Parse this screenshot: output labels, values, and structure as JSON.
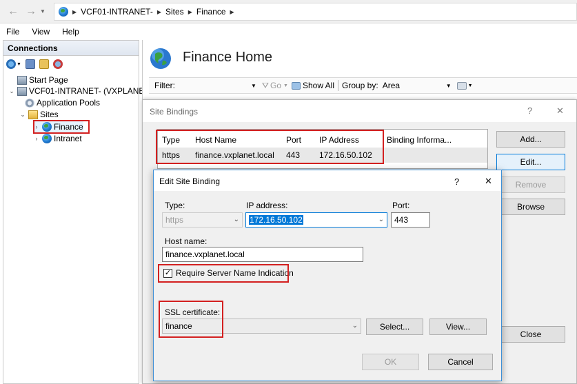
{
  "address": {
    "path": [
      "VCF01-INTRANET-",
      "Sites",
      "Finance"
    ]
  },
  "menu": [
    "File",
    "View",
    "Help"
  ],
  "connections": {
    "title": "Connections",
    "tree": {
      "start_page": "Start Page",
      "server": "VCF01-INTRANET- (VXPLANE",
      "app_pools": "Application Pools",
      "sites": "Sites",
      "finance": "Finance",
      "intranet": "Intranet"
    }
  },
  "home": {
    "title": "Finance Home"
  },
  "filterbar": {
    "filter_label": "Filter:",
    "go_label": "Go",
    "show_all_label": "Show All",
    "group_by_label": "Group by:",
    "group_by_value": "Area"
  },
  "site_bindings": {
    "title": "Site Bindings",
    "help_glyph": "?",
    "close_glyph": "✕",
    "columns": [
      "Type",
      "Host Name",
      "Port",
      "IP Address",
      "Binding Informa..."
    ],
    "rows": [
      {
        "type": "https",
        "host": "finance.vxplanet.local",
        "port": "443",
        "ip": "172.16.50.102",
        "info": ""
      }
    ],
    "buttons": {
      "add": "Add...",
      "edit": "Edit...",
      "remove": "Remove",
      "browse": "Browse",
      "close": "Close"
    }
  },
  "edit_binding": {
    "title": "Edit Site Binding",
    "help_glyph": "?",
    "close_glyph": "✕",
    "type_label": "Type:",
    "type_value": "https",
    "ip_label": "IP address:",
    "ip_value": "172.16.50.102",
    "port_label": "Port:",
    "port_value": "443",
    "host_label": "Host name:",
    "host_value": "finance.vxplanet.local",
    "sni_label": "Require Server Name Indication",
    "sni_checked": true,
    "ssl_label": "SSL certificate:",
    "ssl_value": "finance",
    "select_button": "Select...",
    "view_button": "View...",
    "ok_button": "OK",
    "cancel_button": "Cancel"
  }
}
